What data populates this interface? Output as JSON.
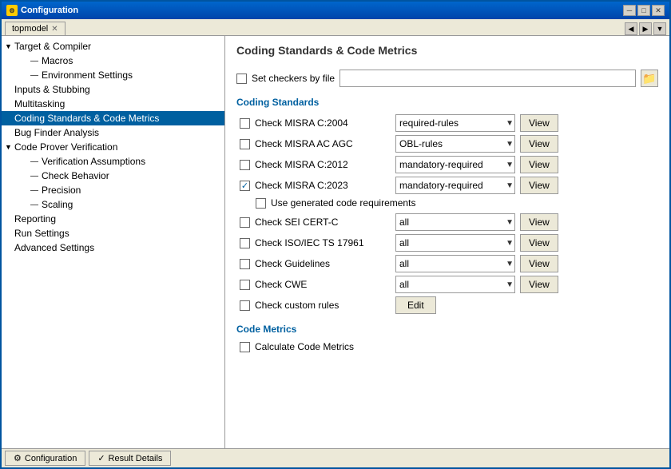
{
  "window": {
    "title": "Configuration",
    "close_btn": "✕",
    "min_btn": "─",
    "max_btn": "□"
  },
  "tabs": {
    "active_tab": "topmodel",
    "nav_prev": "◀",
    "nav_next": "▶",
    "nav_close": "✕"
  },
  "sidebar": {
    "items": [
      {
        "id": "target-compiler",
        "label": "Target & Compiler",
        "level": 0,
        "has_arrow": true,
        "arrow": "▼"
      },
      {
        "id": "macros",
        "label": "Macros",
        "level": 2,
        "has_arrow": false
      },
      {
        "id": "env-settings",
        "label": "Environment Settings",
        "level": 2,
        "has_arrow": false
      },
      {
        "id": "inputs-stubbing",
        "label": "Inputs & Stubbing",
        "level": 0,
        "has_arrow": false
      },
      {
        "id": "multitasking",
        "label": "Multitasking",
        "level": 0,
        "has_arrow": false
      },
      {
        "id": "coding-standards",
        "label": "Coding Standards & Code Metrics",
        "level": 0,
        "has_arrow": false,
        "selected": true
      },
      {
        "id": "bug-finder",
        "label": "Bug Finder Analysis",
        "level": 0,
        "has_arrow": false
      },
      {
        "id": "code-prover",
        "label": "Code Prover Verification",
        "level": 0,
        "has_arrow": true,
        "arrow": "▼"
      },
      {
        "id": "verification-assumptions",
        "label": "Verification Assumptions",
        "level": 2,
        "has_arrow": false
      },
      {
        "id": "check-behavior",
        "label": "Check Behavior",
        "level": 2,
        "has_arrow": false
      },
      {
        "id": "precision",
        "label": "Precision",
        "level": 2,
        "has_arrow": false
      },
      {
        "id": "scaling",
        "label": "Scaling",
        "level": 2,
        "has_arrow": false
      },
      {
        "id": "reporting",
        "label": "Reporting",
        "level": 0,
        "has_arrow": false
      },
      {
        "id": "run-settings",
        "label": "Run Settings",
        "level": 0,
        "has_arrow": false
      },
      {
        "id": "advanced-settings",
        "label": "Advanced Settings",
        "level": 0,
        "has_arrow": false
      }
    ]
  },
  "panel": {
    "title": "Coding Standards & Code Metrics",
    "set_checkers_label": "Set checkers by file",
    "folder_icon": "📁",
    "coding_standards_header": "Coding Standards",
    "code_metrics_header": "Code Metrics",
    "checkers": [
      {
        "id": "misra-2004",
        "label": "Check MISRA C:2004",
        "checked": false,
        "dropdown_value": "required-rules",
        "has_view": true
      },
      {
        "id": "misra-ac-agc",
        "label": "Check MISRA AC AGC",
        "checked": false,
        "dropdown_value": "OBL-rules",
        "has_view": true
      },
      {
        "id": "misra-2012",
        "label": "Check MISRA C:2012",
        "checked": false,
        "dropdown_value": "mandatory-required",
        "has_view": true
      },
      {
        "id": "misra-2023",
        "label": "Check MISRA C:2023",
        "checked": true,
        "dropdown_value": "mandatory-required",
        "has_view": true
      }
    ],
    "use_generated_code": {
      "label": "Use generated code requirements",
      "checked": false
    },
    "additional_checkers": [
      {
        "id": "sei-cert-c",
        "label": "Check SEI CERT-C",
        "checked": false,
        "dropdown_value": "all",
        "has_view": true
      },
      {
        "id": "iso-iec-ts",
        "label": "Check ISO/IEC TS 17961",
        "checked": false,
        "dropdown_value": "all",
        "has_view": true
      },
      {
        "id": "guidelines",
        "label": "Check Guidelines",
        "checked": false,
        "dropdown_value": "all",
        "has_view": true
      },
      {
        "id": "cwe",
        "label": "Check CWE",
        "checked": false,
        "dropdown_value": "all",
        "has_view": true
      },
      {
        "id": "custom-rules",
        "label": "Check custom rules",
        "checked": false,
        "has_edit": true
      }
    ],
    "calculate_metrics": {
      "label": "Calculate Code Metrics",
      "checked": false
    },
    "view_btn": "View",
    "edit_btn": "Edit"
  },
  "bottom_tabs": [
    {
      "id": "configuration",
      "label": "Configuration",
      "icon": "⚙"
    },
    {
      "id": "result-details",
      "label": "Result Details",
      "icon": "✓"
    }
  ]
}
